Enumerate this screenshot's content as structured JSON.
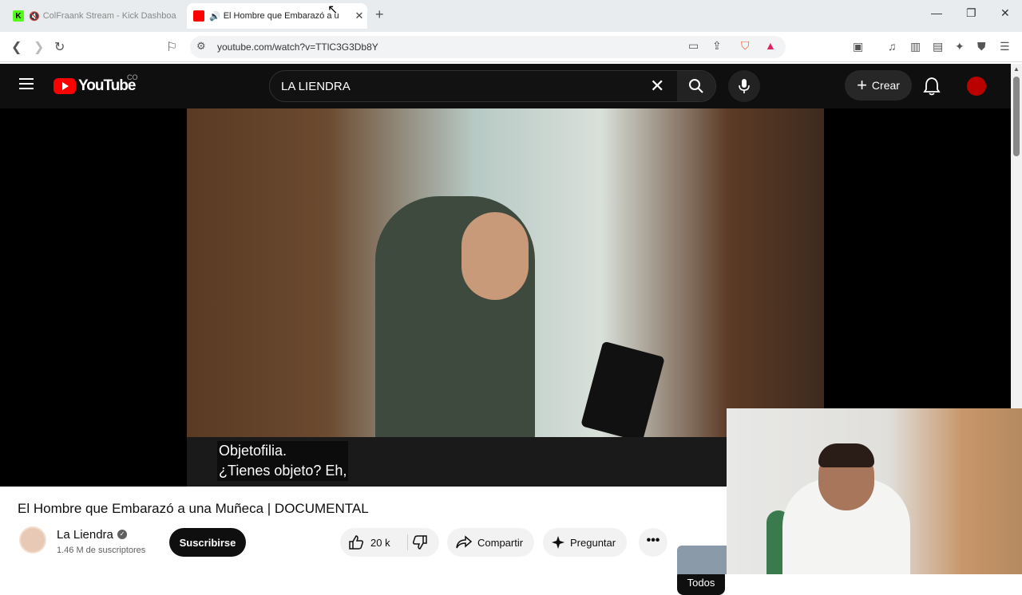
{
  "browser": {
    "tabs": [
      {
        "label": "ColFraank Stream - Kick Dashboa",
        "favicon": "K",
        "muted": true
      },
      {
        "label": "El Hombre que Embarazó a u",
        "active": true,
        "audio": true
      }
    ],
    "url": "youtube.com/watch?v=TTlC3G3Db8Y"
  },
  "youtube": {
    "logo_text": "YouTube",
    "country": "CO",
    "search_query": "LA LIENDRA",
    "create_label": "Crear",
    "colors": {
      "red": "#ff0000",
      "dark": "#0f0f0f"
    }
  },
  "video": {
    "subtitle_line1": "Objetofilia.",
    "subtitle_line2": "¿Tienes objeto? Eh,",
    "title": "El Hombre que Embarazó a una Muñeca | DOCUMENTAL"
  },
  "channel": {
    "name": "La Liendra",
    "subscribers": "1.46 M de suscriptores",
    "subscribe_label": "Suscribirse"
  },
  "actions": {
    "likes": "20 k",
    "share_label": "Compartir",
    "ask_label": "Preguntar"
  },
  "sidebar": {
    "filter_all": "Todos"
  }
}
